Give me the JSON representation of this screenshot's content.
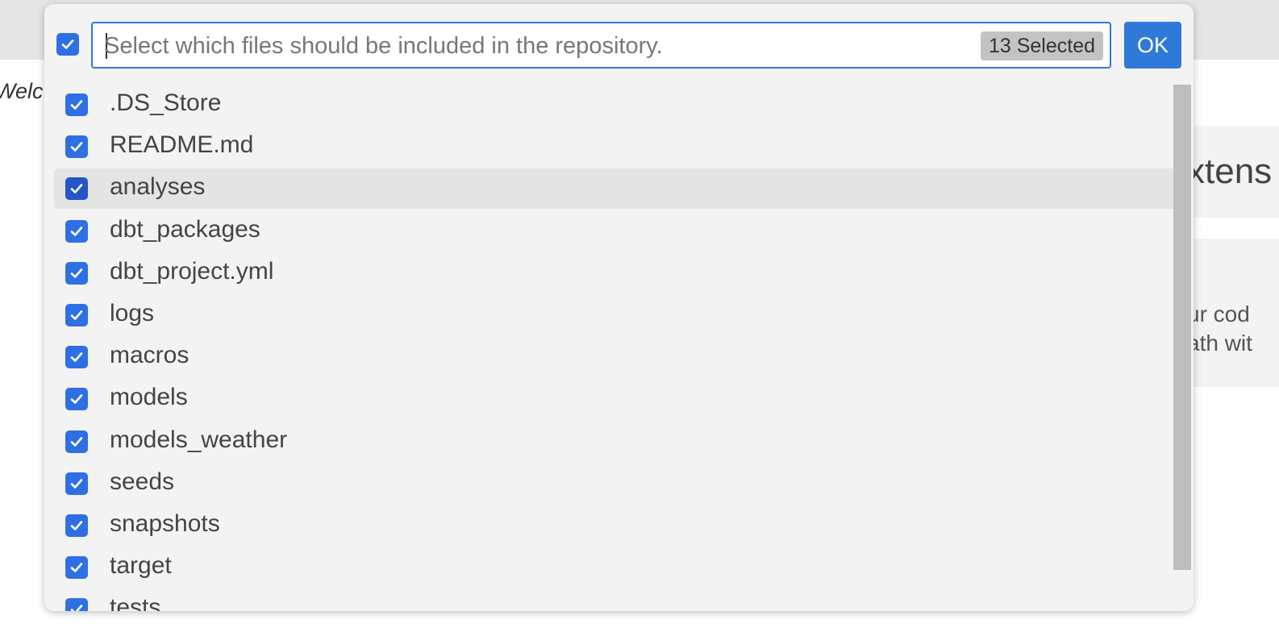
{
  "background": {
    "welcome_fragment": "Welc",
    "card_title_fragment": "xtens",
    "card_line1_fragment": "ur cod",
    "card_line2_fragment": "ath wit"
  },
  "quickpick": {
    "placeholder": "Select which files should be included in the repository.",
    "selected_count": "13 Selected",
    "ok_label": "OK",
    "active_index": 2,
    "items": [
      {
        "label": ".DS_Store",
        "checked": true
      },
      {
        "label": "README.md",
        "checked": true
      },
      {
        "label": "analyses",
        "checked": true
      },
      {
        "label": "dbt_packages",
        "checked": true
      },
      {
        "label": "dbt_project.yml",
        "checked": true
      },
      {
        "label": "logs",
        "checked": true
      },
      {
        "label": "macros",
        "checked": true
      },
      {
        "label": "models",
        "checked": true
      },
      {
        "label": "models_weather",
        "checked": true
      },
      {
        "label": "seeds",
        "checked": true
      },
      {
        "label": "snapshots",
        "checked": true
      },
      {
        "label": "target",
        "checked": true
      },
      {
        "label": "tests",
        "checked": true
      }
    ]
  },
  "colors": {
    "accent": "#2f6fe4",
    "accent_active": "#2456c6",
    "focus_border": "#2f7ad8"
  }
}
